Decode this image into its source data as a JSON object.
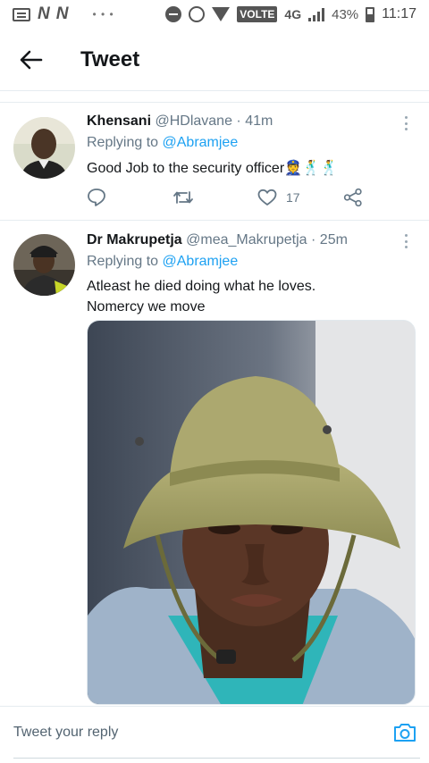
{
  "status_bar": {
    "network_badge": "VOLTE",
    "network_type": "4G",
    "battery": "43%",
    "time": "11:17"
  },
  "header": {
    "title": "Tweet"
  },
  "tweets": [
    {
      "name": "Khensani",
      "handle": "@HDlavane",
      "time": "· 41m",
      "replying_label": "Replying to",
      "replying_to": "@Abramjee",
      "text": "Good Job to the security officer",
      "emoji": "👮🕺🕺",
      "like_count": "17"
    },
    {
      "name": "Dr Makrupetja",
      "handle": "@mea_Makrupetja",
      "time": "· 25m",
      "replying_label": "Replying to",
      "replying_to": "@Abramjee",
      "text_line1": "Atleast he died doing what he loves.",
      "text_line2": "Nomercy we move"
    }
  ],
  "reply_bar": {
    "placeholder": "Tweet your reply"
  },
  "colors": {
    "accent": "#1da1f2",
    "secondary_text": "#657786",
    "divider": "#e6ecf0"
  }
}
